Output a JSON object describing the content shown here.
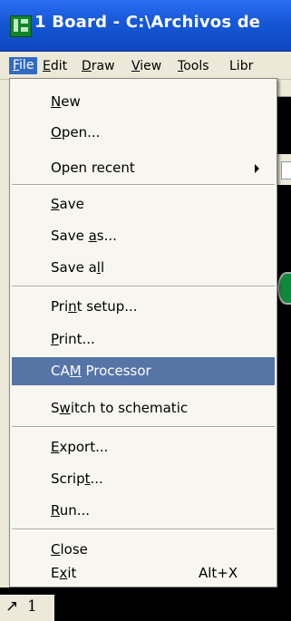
{
  "window": {
    "title": "1 Board - C:\\Archivos de ",
    "icon": "eagle-board-icon"
  },
  "menubar": {
    "items": [
      {
        "pre": "",
        "u": "F",
        "post": "ile"
      },
      {
        "pre": "",
        "u": "E",
        "post": "dit"
      },
      {
        "pre": "",
        "u": "D",
        "post": "raw"
      },
      {
        "pre": "",
        "u": "V",
        "post": "iew"
      },
      {
        "pre": "",
        "u": "T",
        "post": "ools"
      },
      {
        "pre": "",
        "u": "",
        "post": "Libr"
      }
    ]
  },
  "file_menu": {
    "items": [
      {
        "pre": "",
        "u": "N",
        "post": "ew"
      },
      {
        "pre": "",
        "u": "O",
        "post": "pen..."
      },
      {
        "pre": "Open recent",
        "u": "",
        "post": ""
      },
      {
        "pre": "",
        "u": "S",
        "post": "ave"
      },
      {
        "pre": "Save ",
        "u": "a",
        "post": "s..."
      },
      {
        "pre": "Save a",
        "u": "l",
        "post": "l"
      },
      {
        "pre": "Pri",
        "u": "n",
        "post": "t setup..."
      },
      {
        "pre": "",
        "u": "P",
        "post": "rint..."
      },
      {
        "pre": "CA",
        "u": "M",
        "post": " Processor"
      },
      {
        "pre": "S",
        "u": "w",
        "post": "itch to schematic"
      },
      {
        "pre": "",
        "u": "E",
        "post": "xport..."
      },
      {
        "pre": "Scrip",
        "u": "t",
        "post": "..."
      },
      {
        "pre": "",
        "u": "R",
        "post": "un..."
      },
      {
        "pre": "",
        "u": "C",
        "post": "lose"
      },
      {
        "pre": "E",
        "u": "x",
        "post": "it",
        "shortcut": "Alt+X"
      }
    ]
  },
  "bottom_toolbar": {
    "glyph_a": "↗",
    "glyph_b": "1"
  }
}
